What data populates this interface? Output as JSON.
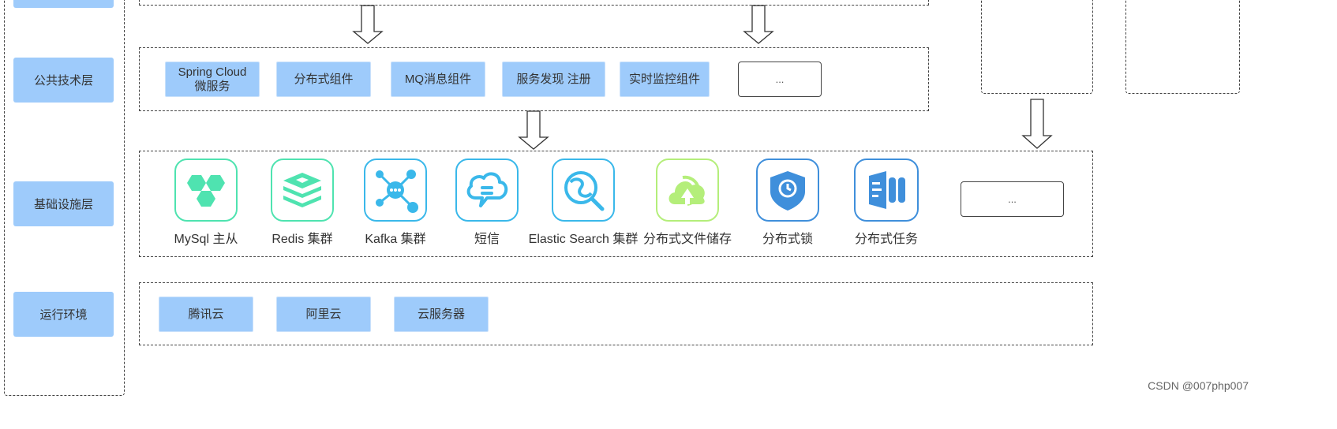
{
  "layers": {
    "public_tech": "公共技术层",
    "infra": "基础设施层",
    "runtime": "运行环境"
  },
  "public_tech_items": [
    "Spring Cloud\n微服务",
    "分布式组件",
    "MQ消息组件",
    "服务发现 注册",
    "实时监控组件"
  ],
  "ellipsis": "...",
  "infra_items": [
    {
      "label": "MySql 主从",
      "icon": "mysql-icon",
      "color": "#4fe3b0"
    },
    {
      "label": "Redis 集群",
      "icon": "redis-icon",
      "color": "#4fe3b0"
    },
    {
      "label": "Kafka 集群",
      "icon": "kafka-icon",
      "color": "#3ab8ea"
    },
    {
      "label": "短信",
      "icon": "sms-icon",
      "color": "#3ab8ea"
    },
    {
      "label": "Elastic Search 集群",
      "icon": "elasticsearch-icon",
      "color": "#3ab8ea"
    },
    {
      "label": "分布式文件储存",
      "icon": "file-storage-icon",
      "color": "#b4ee7a"
    },
    {
      "label": "分布式锁",
      "icon": "lock-icon",
      "color": "#3f8fdb"
    },
    {
      "label": "分布式任务",
      "icon": "task-icon",
      "color": "#3f8fdb"
    }
  ],
  "runtime_items": [
    "腾讯云",
    "阿里云",
    "云服务器"
  ],
  "watermark": "CSDN @007php007",
  "colors": {
    "chip": "#9ecbfb",
    "border": "#444444"
  }
}
